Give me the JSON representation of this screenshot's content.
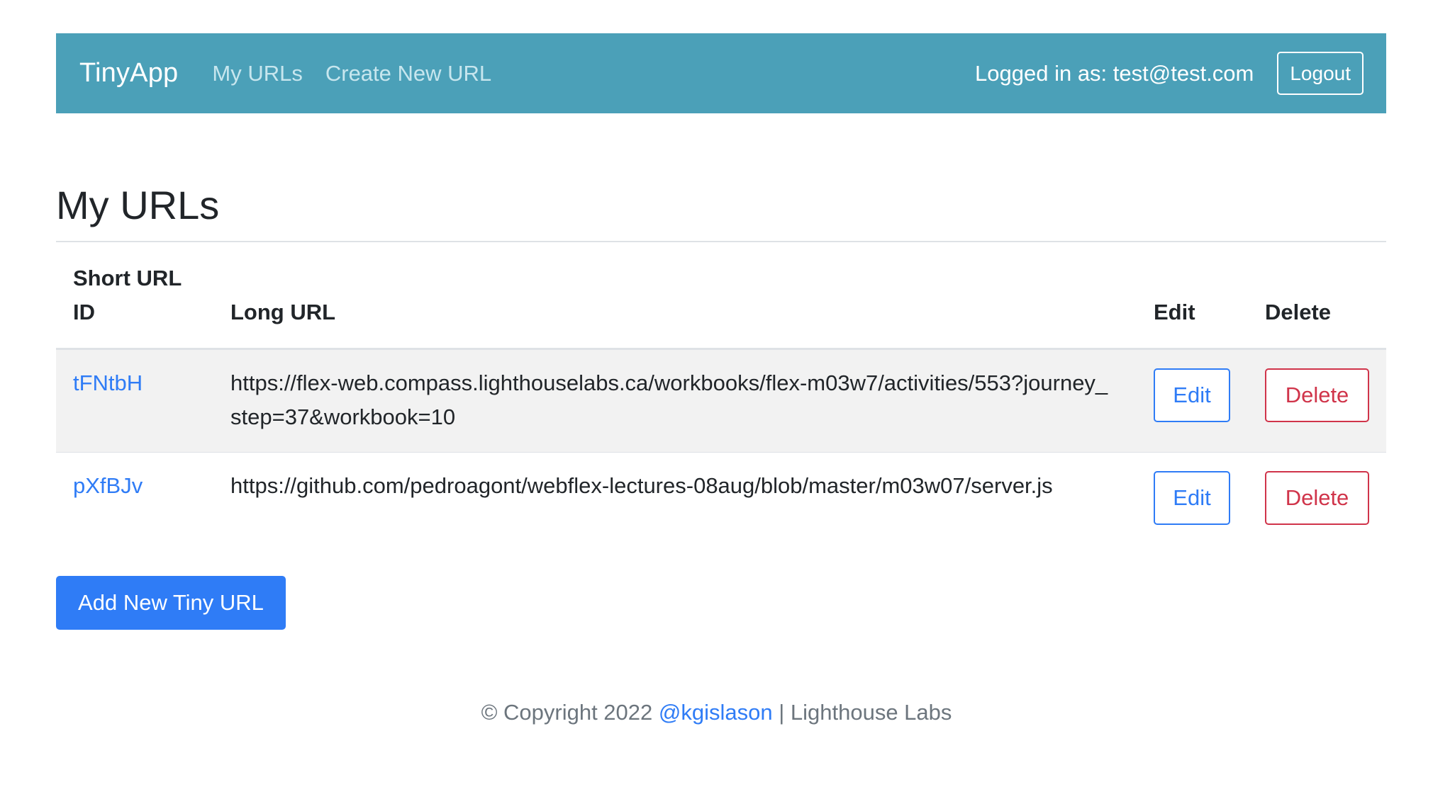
{
  "navbar": {
    "brand": "TinyApp",
    "links": [
      "My URLs",
      "Create New URL"
    ],
    "logged_in_text": "Logged in as: test@test.com",
    "logout_label": "Logout"
  },
  "page": {
    "title": "My URLs"
  },
  "table": {
    "headers": [
      "Short URL ID",
      "Long URL",
      "Edit",
      "Delete"
    ],
    "rows": [
      {
        "short_id": "tFNtbH",
        "long_url": "https://flex-web.compass.lighthouselabs.ca/workbooks/flex-m03w7/activities/553?journey_step=37&workbook=10",
        "edit_label": "Edit",
        "delete_label": "Delete"
      },
      {
        "short_id": "pXfBJv",
        "long_url": "https://github.com/pedroagont/webflex-lectures-08aug/blob/master/m03w07/server.js",
        "edit_label": "Edit",
        "delete_label": "Delete"
      }
    ]
  },
  "add_button_label": "Add New Tiny URL",
  "footer": {
    "prefix": "© Copyright 2022 ",
    "author_link": "@kgislason",
    "suffix": " | Lighthouse Labs"
  },
  "colors": {
    "navbar_bg": "#4ba0b8",
    "primary": "#2f7cf6",
    "danger": "#d0344a",
    "stripe": "#f2f2f2"
  }
}
